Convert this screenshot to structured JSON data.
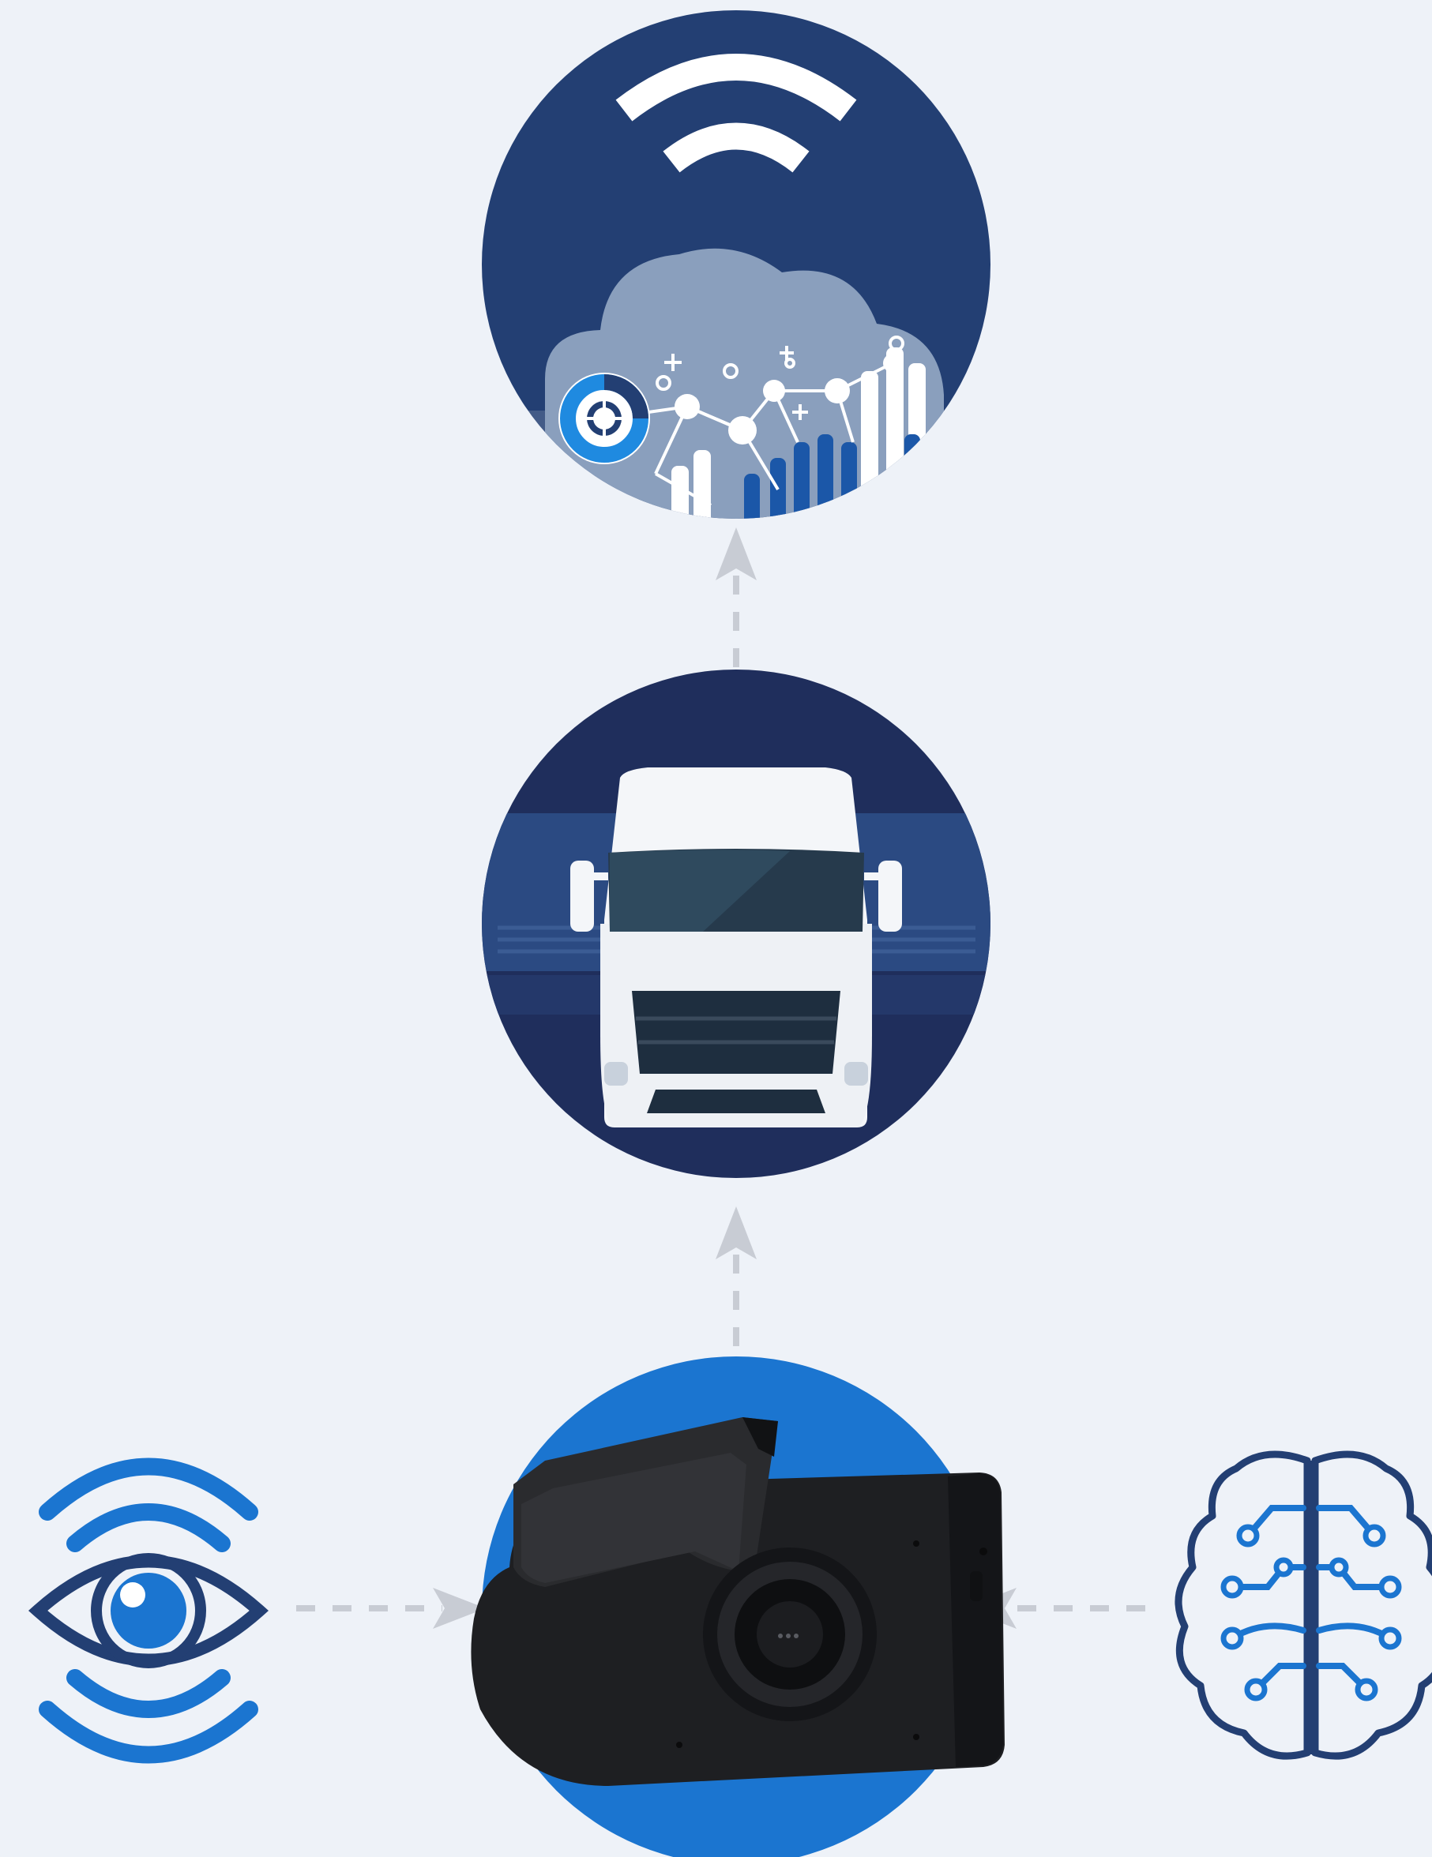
{
  "diagram": {
    "nodes": [
      {
        "id": "cloud-analytics",
        "icon": "cloud-analytics-icon"
      },
      {
        "id": "truck",
        "icon": "truck-icon"
      },
      {
        "id": "dashcam",
        "icon": "dashcam-icon"
      },
      {
        "id": "vision",
        "icon": "eye-sensor-icon"
      },
      {
        "id": "ai-brain",
        "icon": "ai-brain-icon"
      }
    ],
    "edges": [
      {
        "from": "truck",
        "to": "cloud-analytics",
        "style": "dashed-arrow"
      },
      {
        "from": "dashcam",
        "to": "truck",
        "style": "dashed-arrow"
      },
      {
        "from": "vision",
        "to": "dashcam",
        "style": "dashed-arrow"
      },
      {
        "from": "ai-brain",
        "to": "dashcam",
        "style": "dashed-arrow"
      }
    ]
  },
  "colors": {
    "background": "#eef2f8",
    "navy": "#233f73",
    "dark_navy": "#1f2e5c",
    "accent_blue": "#1b75d0",
    "arrow_grey": "#c8ccd4"
  }
}
